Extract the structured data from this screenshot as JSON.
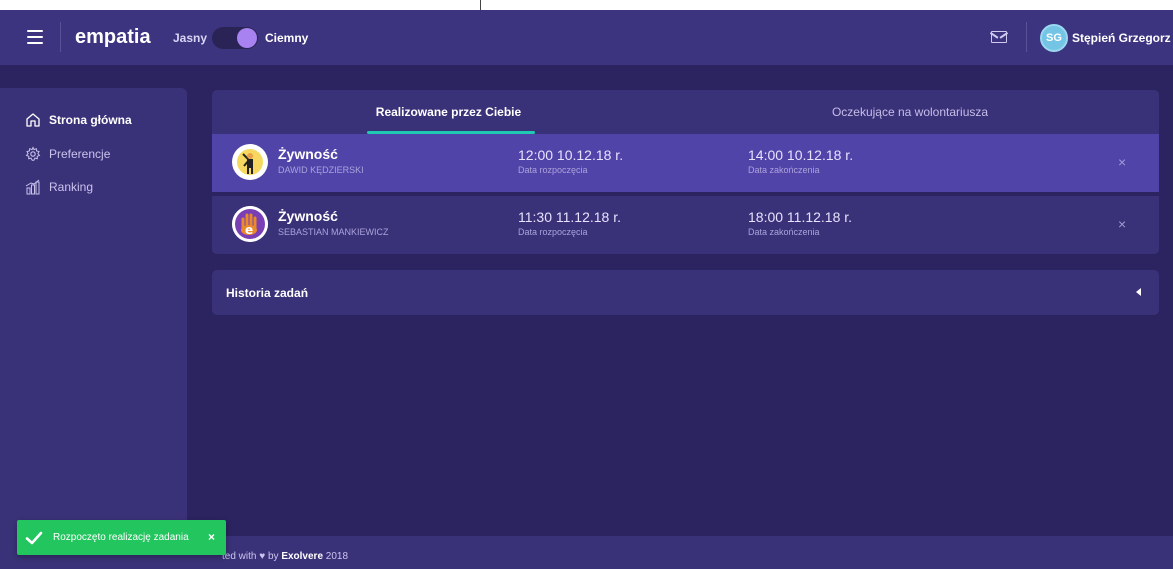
{
  "header": {
    "brand": "empatia",
    "theme_light_label": "Jasny",
    "theme_dark_label": "Ciemny",
    "avatar_initials": "SG",
    "user_name": "Stępień Grzegorz"
  },
  "sidebar": {
    "items": [
      {
        "label": "Strona główna",
        "icon": "home-icon",
        "active": true
      },
      {
        "label": "Preferencje",
        "icon": "gear-icon",
        "active": false
      },
      {
        "label": "Ranking",
        "icon": "ranking-icon",
        "active": false
      }
    ]
  },
  "tabs": [
    {
      "label": "Realizowane przez Ciebie",
      "active": true
    },
    {
      "label": "Oczekujące na wolontariusza",
      "active": false
    }
  ],
  "tasks": [
    {
      "title": "Żywność",
      "person": "DAWID KĘDZIERSKI",
      "start_time": "12:00 10.12.18 r.",
      "start_label": "Data rozpoczęcia",
      "end_time": "14:00 10.12.18 r.",
      "end_label": "Data zakończenia",
      "close": "×"
    },
    {
      "title": "Żywność",
      "person": "SEBASTIAN MANKIEWICZ",
      "start_time": "11:30 11.12.18 r.",
      "start_label": "Data rozpoczęcia",
      "end_time": "18:00 11.12.18 r.",
      "end_label": "Data zakończenia",
      "close": "×"
    }
  ],
  "history": {
    "title": "Historia zadań"
  },
  "footer": {
    "prefix": "ted with",
    "heart": "♥",
    "by": "by",
    "company": "Exolvere",
    "year": "2018"
  },
  "toast": {
    "message": "Rozpoczęto realizację zadania",
    "close": "×"
  },
  "colors": {
    "background": "#2b2460",
    "topbar": "#3d347f",
    "panel": "#3a3278",
    "row_highlight": "#5144a8",
    "accent_tab": "#20c9b2",
    "toast": "#22c55e",
    "toggle_knob": "#a782f0"
  }
}
